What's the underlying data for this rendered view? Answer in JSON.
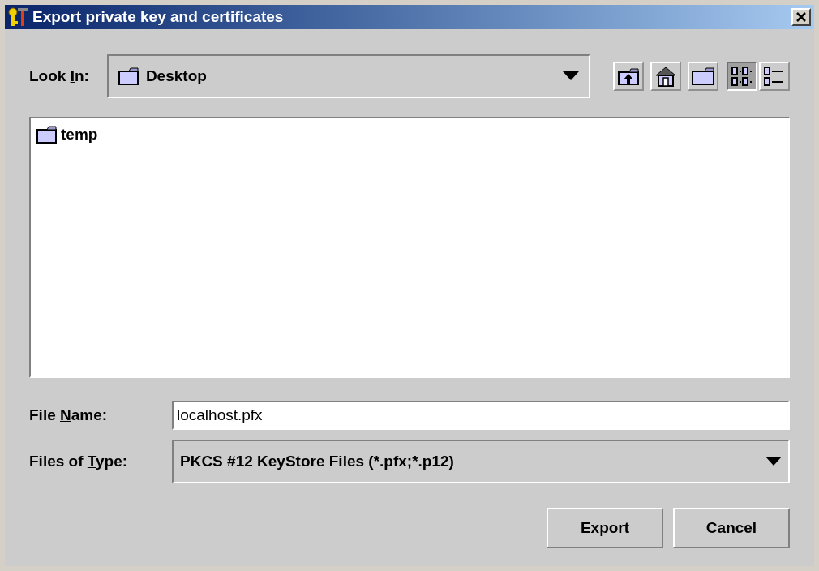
{
  "window": {
    "title": "Export private key and certificates"
  },
  "look_in": {
    "label": {
      "before": "Look ",
      "key": "I",
      "after": "n:"
    },
    "value": "Desktop"
  },
  "toolbar": [
    {
      "kind": "up",
      "selected": false
    },
    {
      "kind": "home",
      "selected": false
    },
    {
      "kind": "new-folder",
      "selected": false
    },
    {
      "kind": "list",
      "selected": true
    },
    {
      "kind": "details",
      "selected": false
    }
  ],
  "files": [
    {
      "name": "temp",
      "selected": false
    }
  ],
  "file_name": {
    "label": {
      "before": "File ",
      "key": "N",
      "after": "ame:"
    },
    "value": "localhost.pfx"
  },
  "file_type": {
    "label": {
      "before": "Files of ",
      "key": "T",
      "after": "ype:"
    },
    "value": "PKCS #12 KeyStore Files (*.pfx;*.p12)"
  },
  "buttons": [
    "Export",
    "Cancel"
  ]
}
